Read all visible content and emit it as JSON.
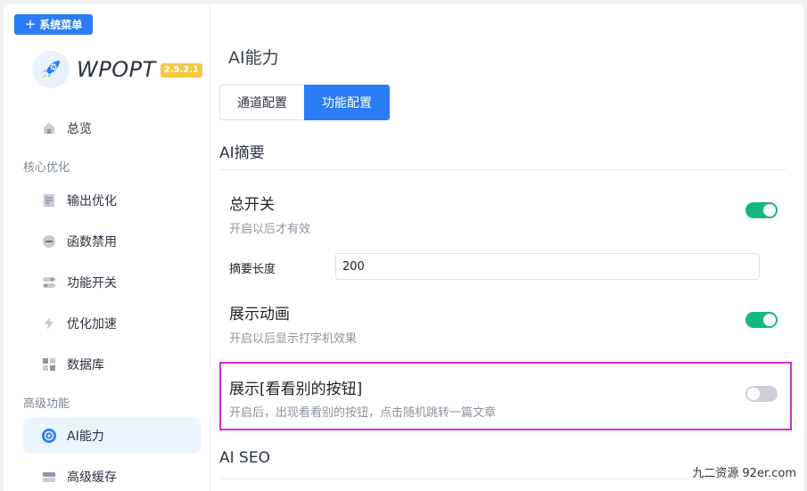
{
  "sidebar": {
    "menu_button": "系统菜单",
    "logo_text": "WPOPT",
    "version": "2.5.2.1",
    "items": {
      "overview": "总览",
      "group_core": "核心优化",
      "output": "输出优化",
      "func_disable": "函数禁用",
      "feature_switch": "功能开关",
      "speed": "优化加速",
      "database": "数据库",
      "group_advanced": "高级功能",
      "ai": "AI能力",
      "cache": "高级缓存"
    }
  },
  "main": {
    "title": "AI能力",
    "tabs": [
      "通道配置",
      "功能配置"
    ],
    "active_tab": "功能配置",
    "section_summary": "AI摘要",
    "master_switch": {
      "title": "总开关",
      "desc": "开启以后才有效",
      "on": true
    },
    "summary_length": {
      "label": "摘要长度",
      "value": "200"
    },
    "animation": {
      "title": "展示动画",
      "desc": "开启以后显示打字机效果",
      "on": true
    },
    "see_other": {
      "title": "展示[看看别的按钮]",
      "desc": "开启后，出现看看别的按钮，点击随机跳转一篇文章",
      "on": false
    },
    "section_seo": "AI SEO"
  },
  "watermark": {
    "cn": "九二资源",
    "en": "92er.com"
  },
  "colors": {
    "accent": "#2b7cf6",
    "toggle_on": "#13b97c",
    "highlight": "#d42dd6",
    "badge": "#f5c842"
  }
}
